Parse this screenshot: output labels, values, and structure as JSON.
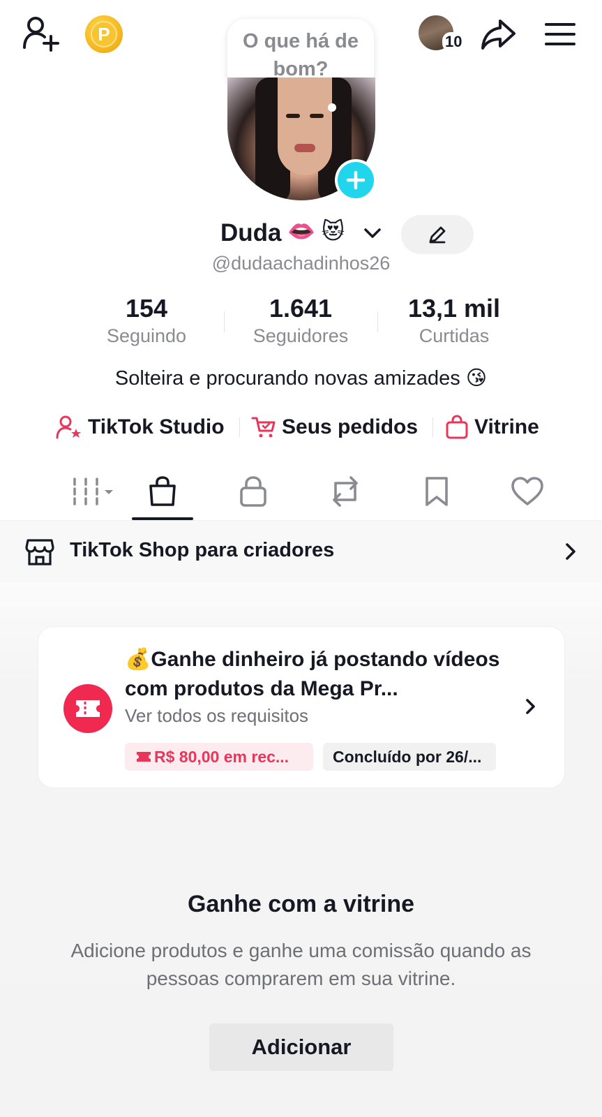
{
  "topbar": {
    "visitor_count": "10",
    "points_letter": "P"
  },
  "profile": {
    "note": "O que há de bom?",
    "display_name": "Duda",
    "name_emoji": "👄 😻",
    "username": "@dudaachadinhos26",
    "bio": "Solteira e procurando novas amizades 😘"
  },
  "stats": [
    {
      "value": "154",
      "label": "Seguindo"
    },
    {
      "value": "1.641",
      "label": "Seguidores"
    },
    {
      "value": "13,1 mil",
      "label": "Curtidas"
    }
  ],
  "links": {
    "studio": "TikTok Studio",
    "orders": "Seus pedidos",
    "showcase": "Vitrine"
  },
  "tabs": [
    "videos-grid",
    "shop",
    "private",
    "reposts",
    "favorites",
    "liked"
  ],
  "shop_banner": {
    "label": "TikTok Shop para criadores"
  },
  "task": {
    "title": "💰Ganhe dinheiro já postando vídeos com produtos da Mega Pr...",
    "subtitle": "Ver todos os requisitos",
    "reward": "R$ 80,00 em rec...",
    "deadline": "Concluído por 26/..."
  },
  "empty_state": {
    "title": "Ganhe com a vitrine",
    "description": "Adicione produtos e ganhe uma comissão quando as pessoas comprarem em sua vitrine.",
    "button": "Adicionar"
  },
  "colors": {
    "accent_cyan": "#20d5ec",
    "accent_red": "#ef2950",
    "link_pink": "#e8365b",
    "text": "#161823",
    "muted": "#8a8b91"
  }
}
